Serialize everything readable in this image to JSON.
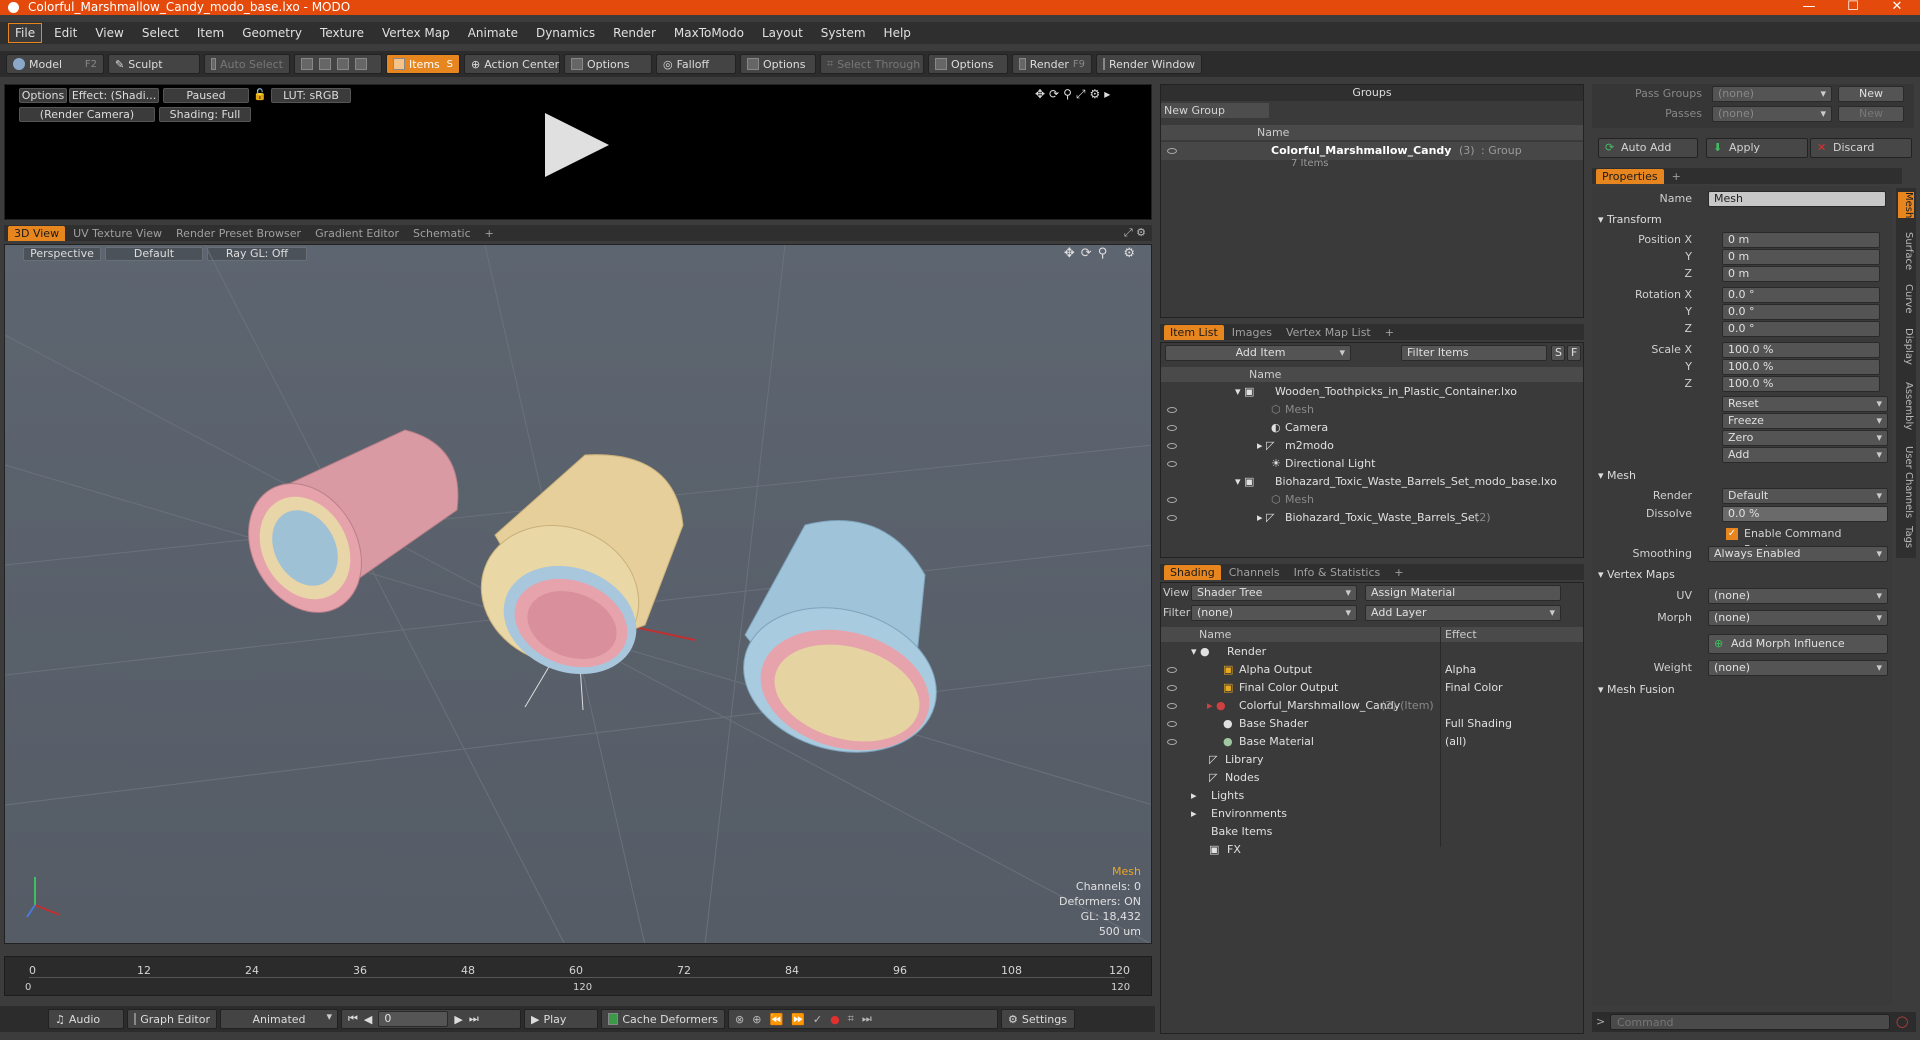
{
  "window": {
    "title": "Colorful_Marshmallow_Candy_modo_base.lxo - MODO",
    "minimize": "—",
    "maximize": "☐",
    "close": "✕"
  },
  "menu": [
    "File",
    "Edit",
    "View",
    "Select",
    "Item",
    "Geometry",
    "Texture",
    "Vertex Map",
    "Animate",
    "Dynamics",
    "Render",
    "MaxToModo",
    "Layout",
    "System",
    "Help"
  ],
  "toolbar": {
    "model": "Model",
    "model_key": "F2",
    "sculpt": "Sculpt",
    "auto_select": "Auto Select",
    "items": "Items",
    "items_key": "S",
    "action_center": "Action Center",
    "options1": "Options",
    "falloff": "Falloff",
    "options2": "Options",
    "select_through": "Select Through",
    "options3": "Options",
    "render": "Render",
    "render_key": "F9",
    "render_window": "Render Window"
  },
  "preview": {
    "options": "Options",
    "effect": "Effect: (Shadi...",
    "paused": "Paused",
    "lut": "LUT: sRGB",
    "camera": "(Render Camera)",
    "shading": "Shading: Full"
  },
  "view_tabs": [
    "3D View",
    "UV Texture View",
    "Render Preset Browser",
    "Gradient Editor",
    "Schematic",
    "+"
  ],
  "viewport": {
    "projection": "Perspective",
    "style": "Default",
    "raygl": "Ray GL: Off",
    "stat_title": "Mesh",
    "channels": "Channels: 0",
    "deformers": "Deformers: ON",
    "gl": "GL: 18,432",
    "unit": "500 um"
  },
  "timeline": {
    "ticks": [
      "0",
      "12",
      "24",
      "36",
      "48",
      "60",
      "72",
      "84",
      "96",
      "108",
      "120"
    ],
    "sub": [
      "0",
      "120",
      "120"
    ],
    "start": "0",
    "end": "120"
  },
  "transport": {
    "audio": "Audio",
    "graph": "Graph Editor",
    "mode": "Animated",
    "frame": "0",
    "play": "Play",
    "cache": "Cache Deformers",
    "settings": "Settings"
  },
  "groups": {
    "title": "Groups",
    "new_group": "New Group",
    "col_name": "Name",
    "item_name": "Colorful_Marshmallow_Candy",
    "item_count": "(3)",
    "item_type": ": Group",
    "item_sub": "7 Items"
  },
  "itemlist": {
    "tabs": [
      "Item List",
      "Images",
      "Vertex Map List",
      "+"
    ],
    "add_item": "Add Item",
    "filter": "Filter Items",
    "s": "S",
    "f": "F",
    "col_name": "Name",
    "rows": [
      "Wooden_Toothpicks_in_Plastic_Container.lxo",
      "Mesh",
      "Camera",
      "m2modo",
      "Directional Light",
      "Biohazard_Toxic_Waste_Barrels_Set_modo_base.lxo",
      "Mesh",
      "Biohazard_Toxic_Waste_Barrels_Set",
      "(2)"
    ]
  },
  "shading": {
    "tabs": [
      "Shading",
      "Channels",
      "Info & Statistics",
      "+"
    ],
    "view_lbl": "View",
    "view_val": "Shader Tree",
    "assign": "Assign Material",
    "filter_lbl": "Filter",
    "filter_val": "(none)",
    "add_layer": "Add Layer",
    "col_name": "Name",
    "col_effect": "Effect",
    "rows": [
      {
        "n": "Render",
        "e": ""
      },
      {
        "n": "Alpha Output",
        "e": "Alpha"
      },
      {
        "n": "Final Color Output",
        "e": "Final Color"
      },
      {
        "n": "Colorful_Marshmallow_Candy",
        "e": "",
        "x": "(2) (Item)"
      },
      {
        "n": "Base Shader",
        "e": "Full Shading"
      },
      {
        "n": "Base Material",
        "e": "(all)"
      },
      {
        "n": "Library",
        "e": ""
      },
      {
        "n": "Nodes",
        "e": ""
      },
      {
        "n": "Lights",
        "e": ""
      },
      {
        "n": "Environments",
        "e": ""
      },
      {
        "n": "Bake Items",
        "e": ""
      },
      {
        "n": "FX",
        "e": ""
      }
    ]
  },
  "passes": {
    "pass_groups": "Pass Groups",
    "passes": "Passes",
    "none": "(none)",
    "new": "New",
    "auto_add": "Auto Add",
    "apply": "Apply",
    "discard": "Discard"
  },
  "properties": {
    "tab": "Properties",
    "name_lbl": "Name",
    "name_val": "Mesh",
    "transform": "Transform",
    "pos_x": "Position X",
    "y": "Y",
    "z": "Z",
    "rot_x": "Rotation X",
    "scale_x": "Scale X",
    "pos": [
      "0 m",
      "0 m",
      "0 m"
    ],
    "rot": [
      "0.0 °",
      "0.0 °",
      "0.0 °"
    ],
    "scale": [
      "100.0 %",
      "100.0 %",
      "100.0 %"
    ],
    "reset": "Reset",
    "freeze": "Freeze",
    "zero": "Zero",
    "add": "Add",
    "mesh": "Mesh",
    "render_lbl": "Render",
    "render_val": "Default",
    "dissolve_lbl": "Dissolve",
    "dissolve_val": "0.0 %",
    "cmd_regions": "Enable Command Regions",
    "smoothing_lbl": "Smoothing",
    "smoothing_val": "Always Enabled",
    "vmaps": "Vertex Maps",
    "uv_lbl": "UV",
    "morph_lbl": "Morph",
    "add_morph": "Add Morph Influence",
    "weight_lbl": "Weight",
    "none": "(none)",
    "mesh_fusion": "Mesh Fusion",
    "side_tabs": [
      "Mesh",
      "Surface",
      "Curve",
      "Display",
      "Assembly",
      "User Channels",
      "Tags"
    ]
  },
  "command": {
    "placeholder": "Command"
  }
}
